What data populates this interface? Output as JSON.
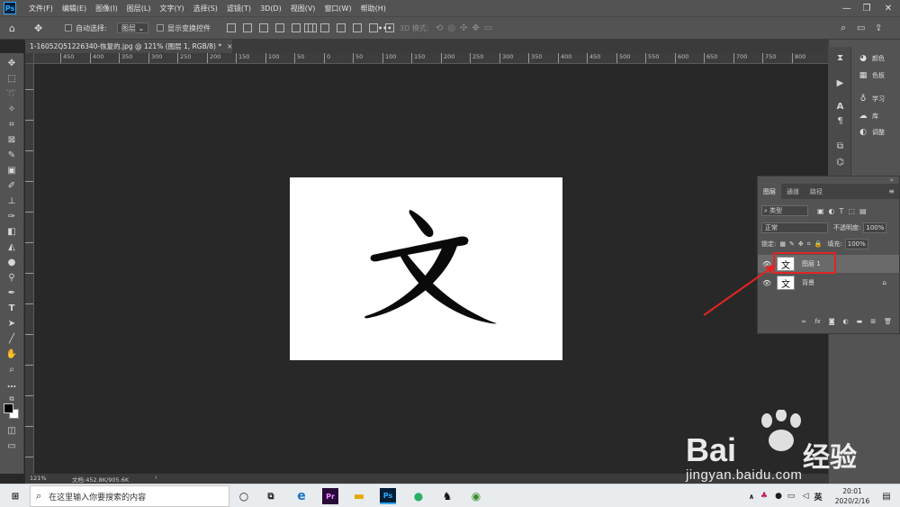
{
  "app": {
    "logo_text": "Ps",
    "menu": [
      "文件(F)",
      "编辑(E)",
      "图像(I)",
      "图层(L)",
      "文字(Y)",
      "选择(S)",
      "滤镜(T)",
      "3D(D)",
      "视图(V)",
      "窗口(W)",
      "帮助(H)"
    ]
  },
  "options_bar": {
    "auto_select_label": "自动选择:",
    "auto_select_value": "图层",
    "show_transform_label": "显示变换控件",
    "mode_3d_label": "3D 模式:"
  },
  "document": {
    "tab_title": "1-16052Q51226340-恢复的.jpg @ 121% (图层 1, RGB/8) *",
    "canvas_char": "文"
  },
  "rulers": {
    "h_labels": [
      "450",
      "400",
      "350",
      "300",
      "250",
      "200",
      "150",
      "100",
      "50",
      "0",
      "50",
      "100",
      "150",
      "200",
      "250",
      "300",
      "350",
      "400",
      "450",
      "500",
      "550",
      "600",
      "650",
      "700",
      "750",
      "800",
      "850",
      "900"
    ]
  },
  "status": {
    "zoom": "121%",
    "doc_info": "文档:452.8K/905.6K",
    "arrow": "›"
  },
  "side_panels": {
    "color": "颜色",
    "swatches": "色板",
    "learn": "学习",
    "library": "库",
    "adjust": "调整"
  },
  "layers_panel": {
    "tabs": [
      "图层",
      "通道",
      "路径"
    ],
    "filter_label": "类型",
    "blend_mode": "正常",
    "opacity_label": "不透明度:",
    "opacity_value": "100%",
    "lock_label": "锁定:",
    "fill_label": "填充:",
    "fill_value": "100%",
    "layers": [
      {
        "name": "图层 1",
        "thumb": "文",
        "selected": true
      },
      {
        "name": "背景",
        "thumb": "文",
        "selected": false
      }
    ],
    "footer_fx": "fx"
  },
  "taskbar": {
    "search_placeholder": "在这里输入你要搜索的内容",
    "apps": [
      "e",
      "Pr",
      "Ps"
    ],
    "ime": "英",
    "time": "20:01",
    "date": "2020/2/16"
  },
  "watermark": {
    "brand": "Bai",
    "brand2": "经验",
    "url": "jingyan.baidu.com"
  },
  "colors": {
    "highlight_box": "#e02424",
    "arrow": "#e02424",
    "ps_blue": "#31a8ff"
  }
}
